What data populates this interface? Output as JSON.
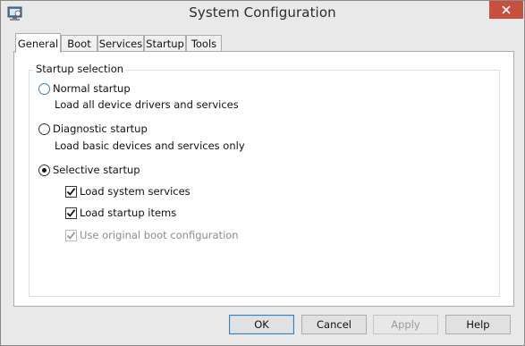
{
  "window": {
    "title": "System Configuration",
    "close_icon": "close-icon",
    "app_icon": "system-config-icon"
  },
  "tabs": [
    {
      "label": "General",
      "active": true
    },
    {
      "label": "Boot",
      "active": false
    },
    {
      "label": "Services",
      "active": false
    },
    {
      "label": "Startup",
      "active": false
    },
    {
      "label": "Tools",
      "active": false
    }
  ],
  "general": {
    "group_label": "Startup selection",
    "normal": {
      "label": "Normal startup",
      "description": "Load all device drivers and services",
      "selected": false
    },
    "diagnostic": {
      "label": "Diagnostic startup",
      "description": "Load basic devices and services only",
      "selected": false
    },
    "selective": {
      "label": "Selective startup",
      "selected": true,
      "options": {
        "system_services": {
          "label": "Load system services",
          "checked": true,
          "enabled": true
        },
        "startup_items": {
          "label": "Load startup items",
          "checked": true,
          "enabled": true
        },
        "original_boot": {
          "label": "Use original boot configuration",
          "checked": true,
          "enabled": false
        }
      }
    }
  },
  "buttons": {
    "ok": "OK",
    "cancel": "Cancel",
    "apply": "Apply",
    "help": "Help"
  },
  "colors": {
    "close_button": "#c7503f",
    "focus_blue": "#3c7fb1"
  }
}
